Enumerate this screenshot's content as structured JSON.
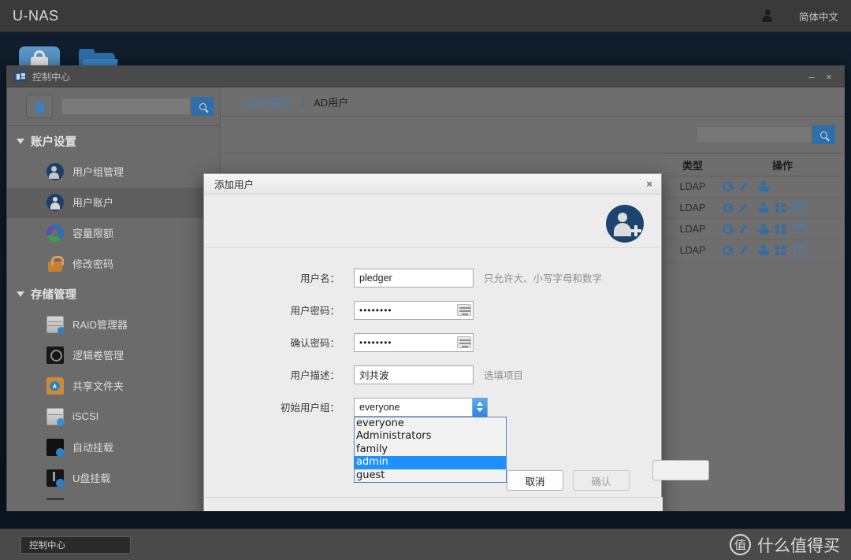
{
  "topbar": {
    "brand": "U-NAS",
    "user_icon": "person-icon",
    "language": "简体中文"
  },
  "desktop": {
    "icons": [
      {
        "name": "lock-app-icon",
        "label": ""
      },
      {
        "name": "folder-app-icon",
        "label": ""
      }
    ]
  },
  "window": {
    "title": "控制中心",
    "title_icon": "control-center-icon",
    "minimize": "–",
    "close": "×"
  },
  "sidebar": {
    "home_icon": "home-icon",
    "search_value": "",
    "search_placeholder": "",
    "search_icon": "search-icon",
    "groups": [
      {
        "label": "账户设置",
        "items": [
          {
            "label": "用户组管理",
            "icon": "user-group-icon",
            "selected": false
          },
          {
            "label": "用户账户",
            "icon": "user-account-icon",
            "selected": true
          },
          {
            "label": "容量限额",
            "icon": "quota-pie-icon",
            "selected": false
          },
          {
            "label": "修改密码",
            "icon": "lock-icon",
            "selected": false
          }
        ]
      },
      {
        "label": "存储管理",
        "items": [
          {
            "label": "RAID管理器",
            "icon": "raid-icon",
            "selected": false
          },
          {
            "label": "逻辑卷管理",
            "icon": "lvm-icon",
            "selected": false
          },
          {
            "label": "共享文件夹",
            "icon": "shared-folder-icon",
            "selected": false
          },
          {
            "label": "iSCSI",
            "icon": "iscsi-icon",
            "selected": false
          },
          {
            "label": "自动挂载",
            "icon": "automount-icon",
            "selected": false
          },
          {
            "label": "U盘挂载",
            "icon": "usb-mount-icon",
            "selected": false
          }
        ]
      }
    ]
  },
  "content": {
    "tabs": [
      {
        "label": "LDAP用户",
        "active": true
      },
      {
        "label": "AD用户",
        "active": false
      }
    ],
    "tab_separator": "|",
    "search_value": "",
    "search_icon": "search-icon",
    "table": {
      "headers": [
        "类型",
        "操作"
      ],
      "rows": [
        {
          "type": "LDAP",
          "ops": [
            "key-icon",
            "pen-icon",
            "group-icon"
          ]
        },
        {
          "type": "LDAP",
          "ops": [
            "key-icon",
            "pen-icon",
            "group-icon",
            "apps-icon",
            "trash-icon"
          ]
        },
        {
          "type": "LDAP",
          "ops": [
            "key-icon",
            "pen-icon",
            "group-icon",
            "apps-icon",
            "trash-icon"
          ]
        },
        {
          "type": "LDAP",
          "ops": [
            "key-icon",
            "pen-icon",
            "group-icon",
            "apps-icon",
            "trash-icon"
          ]
        }
      ]
    }
  },
  "dialog": {
    "title": "添加用户",
    "close": "×",
    "avatar_icon": "add-user-avatar-icon",
    "fields": {
      "username": {
        "label": "用户名：",
        "value": "pledger",
        "hint": "只允许大、小写字母和数字"
      },
      "password": {
        "label": "用户密码：",
        "value": "••••••••",
        "keyboard_icon": "keyboard-icon"
      },
      "confirm": {
        "label": "确认密码：",
        "value": "••••••••",
        "keyboard_icon": "keyboard-icon"
      },
      "description": {
        "label": "用户描述：",
        "value": "刘共波",
        "hint": "选填项目"
      },
      "primary_group": {
        "label": "初始用户组：",
        "value": "everyone"
      }
    },
    "group_options": [
      {
        "label": "everyone",
        "selected": false
      },
      {
        "label": "Administrators",
        "selected": false
      },
      {
        "label": "family",
        "selected": false
      },
      {
        "label": "admin",
        "selected": true
      },
      {
        "label": "guest",
        "selected": false
      }
    ],
    "buttons": {
      "cancel": "取消",
      "confirm": "确认"
    }
  },
  "taskbar": {
    "item": "控制中心",
    "watermark_badge": "值",
    "watermark_text": "什么值得买"
  },
  "colors": {
    "accent_blue": "#2f6ea8",
    "select_blue": "#1e90ff",
    "window_gray": "#6e6e6e",
    "dialog_bg": "#ececec",
    "topbar": "#3a3a3a"
  }
}
